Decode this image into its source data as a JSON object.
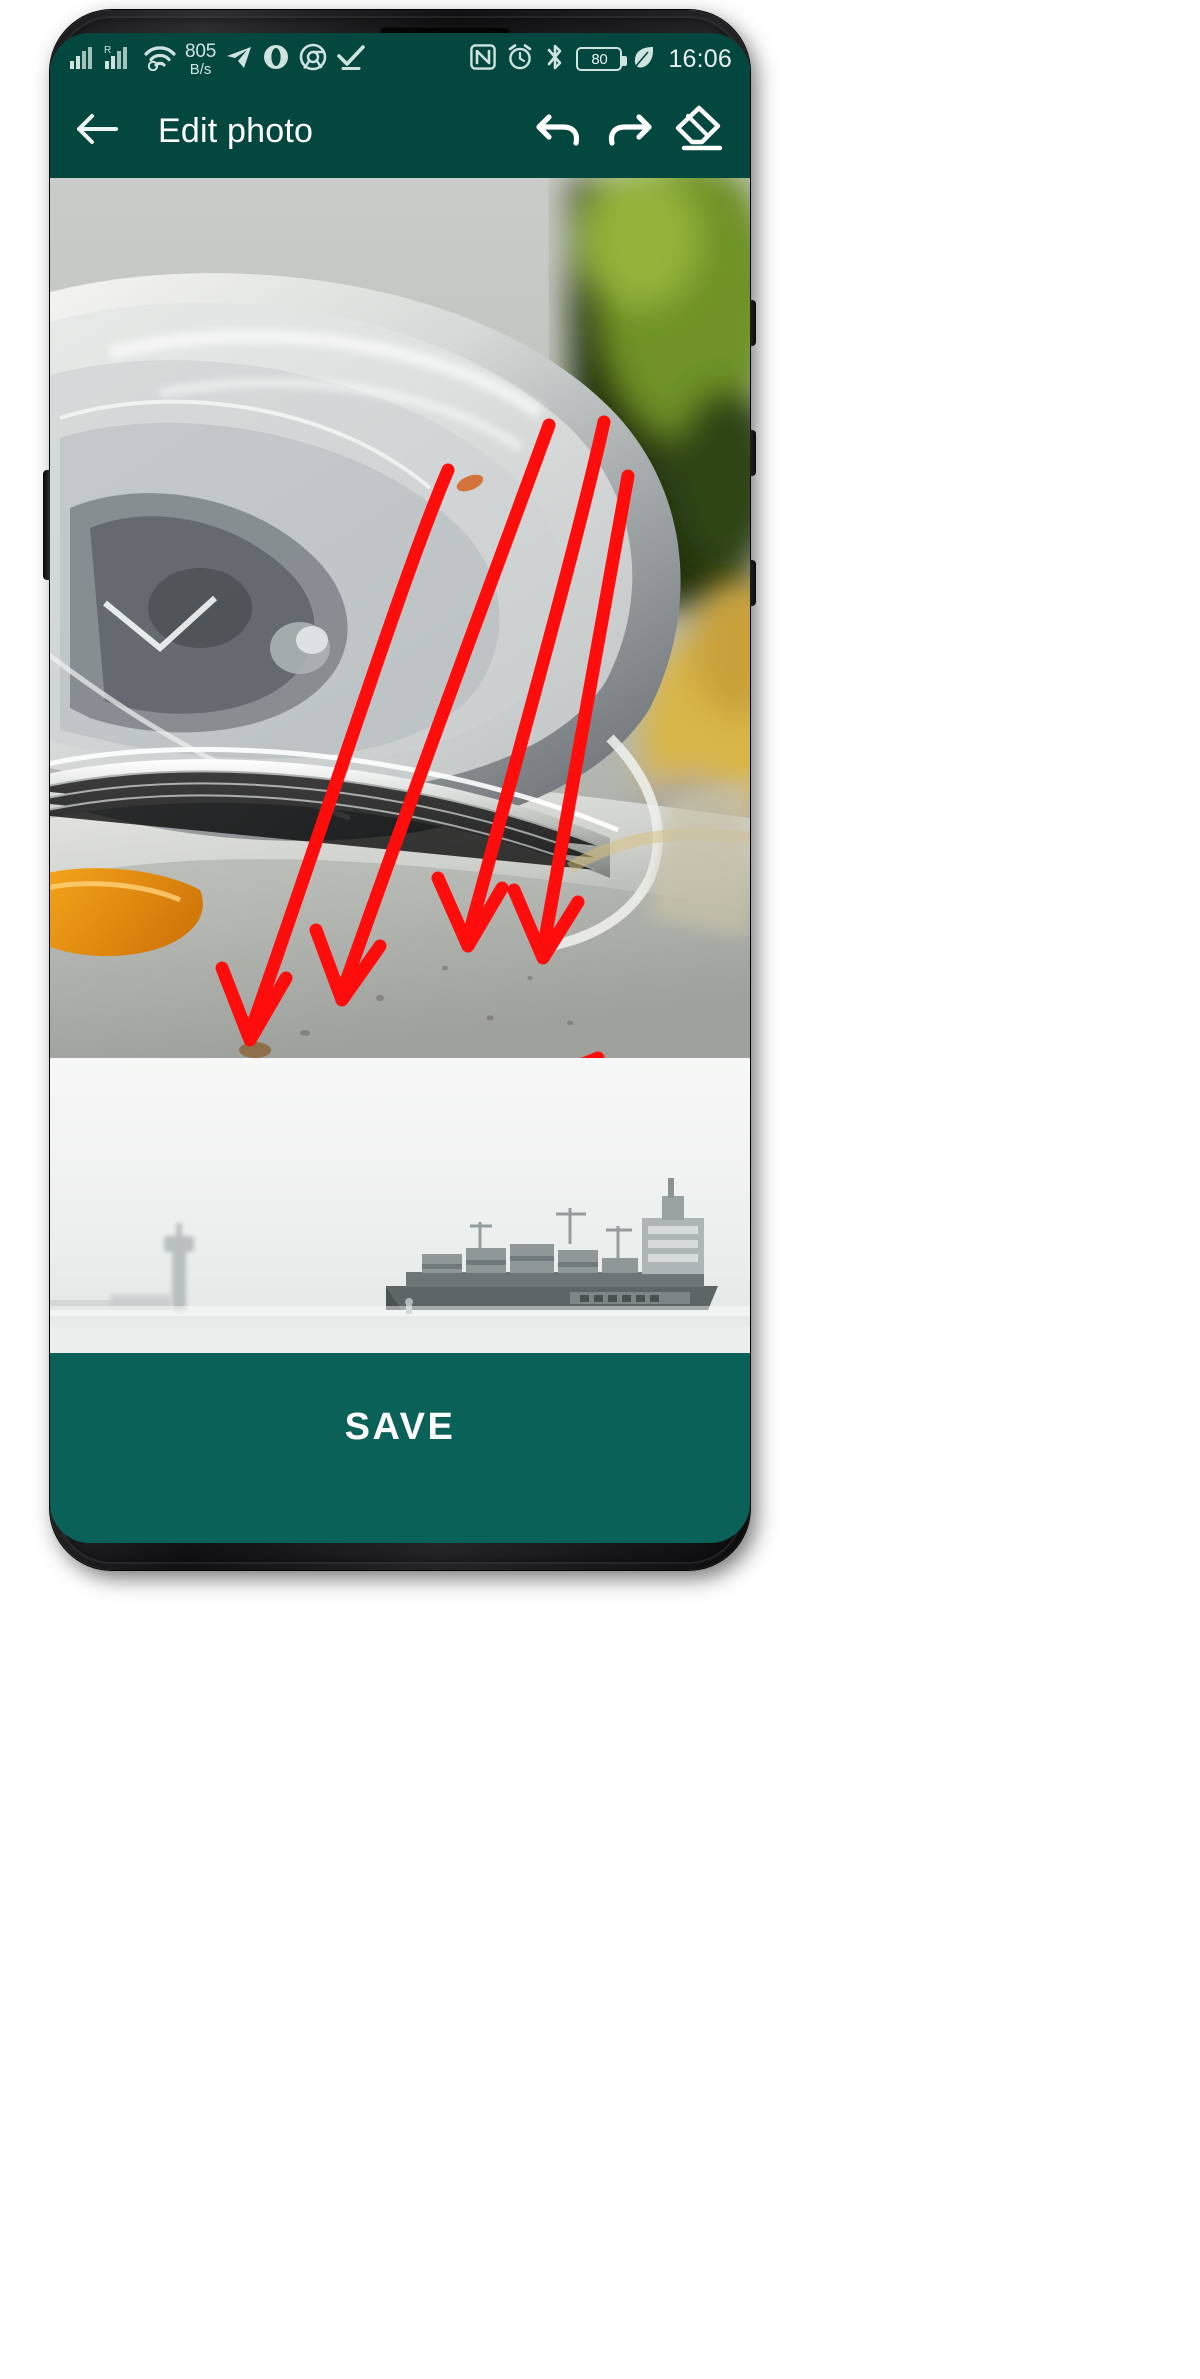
{
  "theme": {
    "toolbar_color": "#04473F",
    "save_bar_color": "#0A6157",
    "status_text_color": "#CFE3DF",
    "annotation_color": "#FF0D0D",
    "title_color": "#FFFFFF"
  },
  "status_bar": {
    "left_icons": [
      {
        "name": "signal-bars-icon",
        "label": "signal"
      },
      {
        "name": "signal-roaming-icon",
        "label": "R"
      },
      {
        "name": "wifi-icon",
        "label": "wifi"
      }
    ],
    "network_speed": {
      "value": "805",
      "unit": "B/s"
    },
    "notification_icons": [
      {
        "name": "telegram-icon",
        "label": "Telegram"
      },
      {
        "name": "opera-icon",
        "label": "Opera"
      },
      {
        "name": "chrome-icon",
        "label": "Chrome"
      },
      {
        "name": "checkmark-icon",
        "label": "Done"
      }
    ],
    "right_icons": [
      {
        "name": "nfc-icon",
        "label": "NFC"
      },
      {
        "name": "alarm-icon",
        "label": "Alarm"
      },
      {
        "name": "bluetooth-icon",
        "label": "Bluetooth"
      }
    ],
    "battery": {
      "percent": "80"
    },
    "power_saving_icon": "leaf-icon",
    "time": "16:06"
  },
  "toolbar": {
    "back_icon": "arrow-left-icon",
    "title": "Edit photo",
    "actions": [
      {
        "name": "undo-button",
        "icon": "undo-icon",
        "label": "Undo"
      },
      {
        "name": "redo-button",
        "icon": "redo-icon",
        "label": "Redo"
      },
      {
        "name": "eraser-button",
        "icon": "eraser-icon",
        "label": "Eraser"
      }
    ]
  },
  "canvas": {
    "photo_alt": "Close-up of a car headlight and white body panel",
    "annotation_count": "4 arrows and 1 underline stroke",
    "annotation_color": "#FF0D0D"
  },
  "strip": {
    "photo_alt": "Container ship on misty water with a lighthouse"
  },
  "save_bar": {
    "label": "SAVE"
  }
}
